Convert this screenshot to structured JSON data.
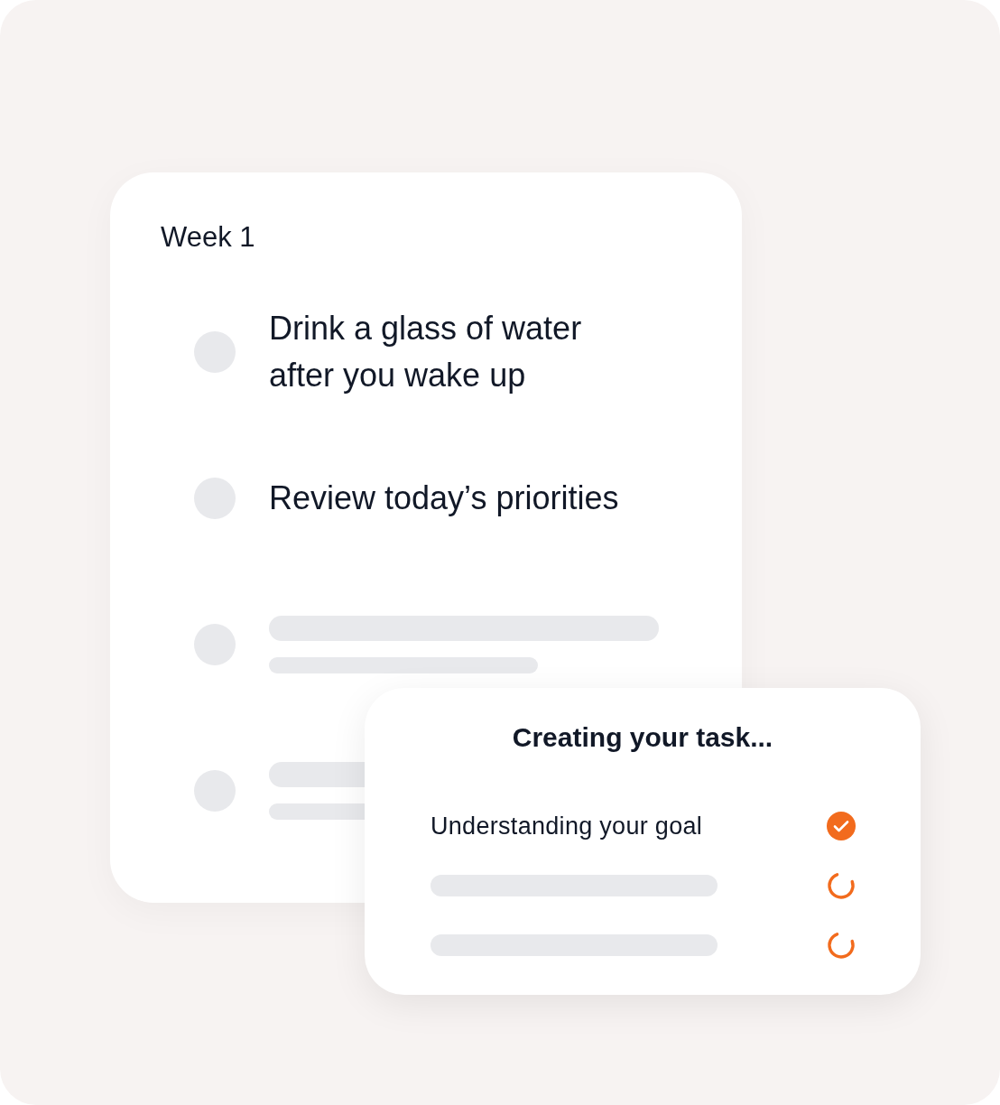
{
  "week_card": {
    "title": "Week 1",
    "tasks": [
      {
        "kind": "text",
        "label": "Drink a glass of water after you wake up",
        "checked": false
      },
      {
        "kind": "text",
        "label": "Review today’s priorities",
        "checked": false
      },
      {
        "kind": "placeholder",
        "checked": false
      },
      {
        "kind": "placeholder",
        "checked": false
      }
    ]
  },
  "progress_card": {
    "title": "Creating your task...",
    "steps": [
      {
        "kind": "text",
        "label": "Understanding your goal",
        "done": true
      },
      {
        "kind": "placeholder",
        "done": false
      },
      {
        "kind": "placeholder",
        "done": false
      }
    ]
  }
}
